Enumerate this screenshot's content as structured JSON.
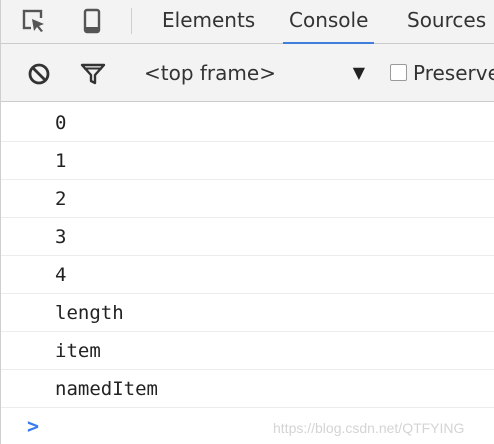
{
  "tabbar": {
    "tabs": [
      {
        "label": "Elements",
        "active": false
      },
      {
        "label": "Console",
        "active": true
      },
      {
        "label": "Sources",
        "active": false
      }
    ],
    "icons": [
      "inspect-element-icon",
      "device-toolbar-icon"
    ]
  },
  "toolbar": {
    "clear_icon": "clear-console-icon",
    "filter_icon": "filter-icon",
    "context_value": "<top frame>",
    "context_arrow": "▼",
    "preserve_label": "Preserve"
  },
  "console": {
    "messages": [
      "0",
      "1",
      "2",
      "3",
      "4",
      "length",
      "item",
      "namedItem"
    ],
    "prompt": ">"
  },
  "watermark": "https://blog.csdn.net/QTFYING",
  "colors": {
    "accent": "#3f7fdb",
    "prompt": "#367cf1",
    "toolbar_bg": "#f3f3f3"
  }
}
